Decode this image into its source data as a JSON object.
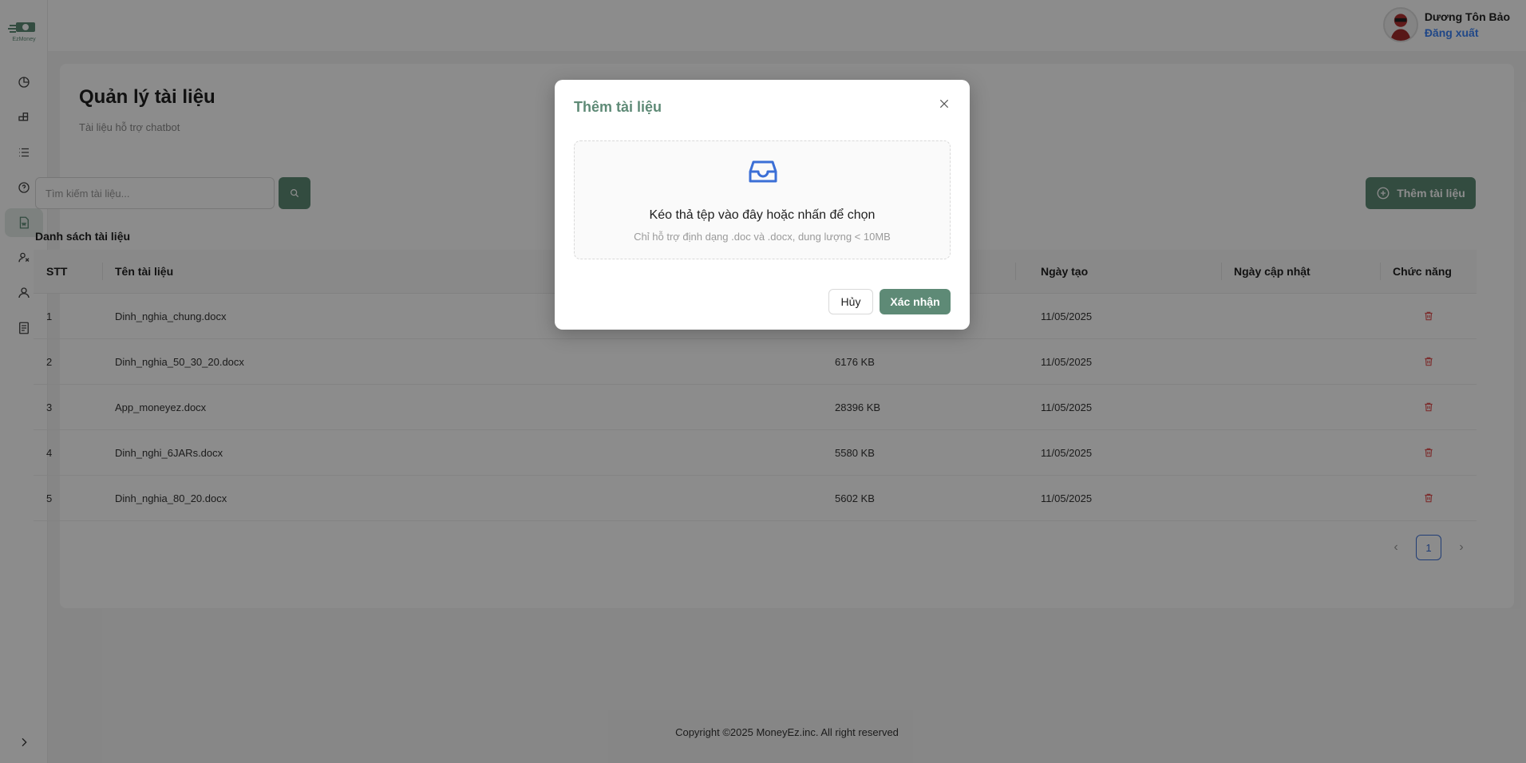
{
  "app": {
    "logo_alt": "MoneyEz"
  },
  "sidebar": {
    "items": [
      {
        "name": "dashboard",
        "icon": "pie-chart-icon"
      },
      {
        "name": "categories",
        "icon": "blocks-icon"
      },
      {
        "name": "list",
        "icon": "list-icon"
      },
      {
        "name": "faq",
        "icon": "question-icon"
      },
      {
        "name": "documents",
        "icon": "document-icon",
        "active": true
      },
      {
        "name": "groups",
        "icon": "users-icon"
      },
      {
        "name": "users",
        "icon": "user-icon"
      },
      {
        "name": "reports",
        "icon": "report-icon"
      }
    ]
  },
  "header": {
    "user_name": "Dương Tôn Bảo",
    "logout_label": "Đăng xuất"
  },
  "page": {
    "title": "Quản lý tài liệu",
    "subtitle": "Tài liệu hỗ trợ chatbot",
    "search_placeholder": "Tìm kiếm tài liệu...",
    "add_button_label": "Thêm tài liệu",
    "list_title": "Danh sách tài liệu"
  },
  "table": {
    "columns": {
      "stt": "STT",
      "name": "Tên tài liệu",
      "created": "Ngày tạo",
      "updated": "Ngày cập nhật",
      "actions": "Chức năng"
    },
    "rows": [
      {
        "stt": "1",
        "name": "Dinh_nghia_chung.docx",
        "size": "",
        "created": "11/05/2025",
        "updated": ""
      },
      {
        "stt": "2",
        "name": "Dinh_nghia_50_30_20.docx",
        "size": "6176 KB",
        "created": "11/05/2025",
        "updated": ""
      },
      {
        "stt": "3",
        "name": "App_moneyez.docx",
        "size": "28396 KB",
        "created": "11/05/2025",
        "updated": ""
      },
      {
        "stt": "4",
        "name": "Dinh_nghi_6JARs.docx",
        "size": "5580 KB",
        "created": "11/05/2025",
        "updated": ""
      },
      {
        "stt": "5",
        "name": "Dinh_nghia_80_20.docx",
        "size": "5602 KB",
        "created": "11/05/2025",
        "updated": ""
      }
    ]
  },
  "pagination": {
    "current_page": "1",
    "prev": "‹",
    "next": "›"
  },
  "footer": {
    "text": "Copyright ©2025 MoneyEz.inc. All right reserved"
  },
  "modal": {
    "title": "Thêm tài liệu",
    "drop_text": "Kéo thả tệp vào đây hoặc nhấn để chọn",
    "drop_hint": "Chỉ hỗ trợ định dạng .doc và .docx, dung lượng < 10MB",
    "cancel_label": "Hủy",
    "confirm_label": "Xác nhận"
  },
  "colors": {
    "primary": "#5e8a76",
    "accent_blue": "#3b82f6",
    "danger": "#e25555",
    "inbox_icon": "#3b6fd6"
  }
}
